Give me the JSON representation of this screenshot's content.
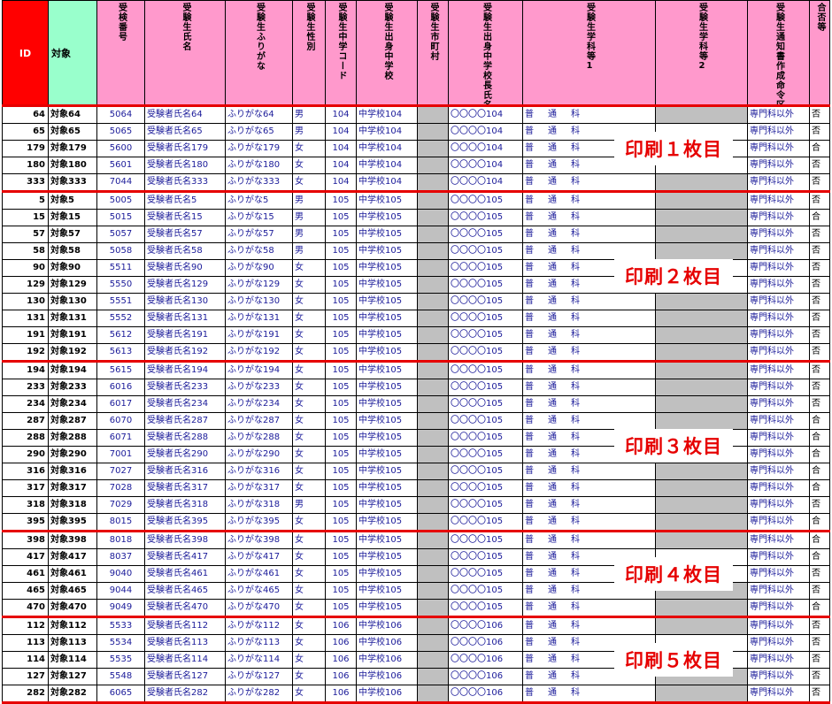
{
  "headers": {
    "id": "ID",
    "target": "対象",
    "exam_no": "受検番号",
    "name": "受験生氏名",
    "kana": "受験生ふりがな",
    "sex": "受験生性別",
    "jhs_code": "受験生中学コード",
    "jhs": "受験生出身中学校",
    "city": "受験生市町村",
    "principal": "受験生出身中学校長氏名",
    "course1": "受験生学科等1",
    "course2": "受験生学科等2",
    "notice": "受験生通知書作成命令区分",
    "pass": "合否等"
  },
  "print_labels": [
    "印刷１枚目",
    "印刷２枚目",
    "印刷３枚目",
    "印刷４枚目",
    "印刷５枚目"
  ],
  "groups": [
    {
      "rows": [
        {
          "id": "64",
          "target": "対象64",
          "exam": "5064",
          "name": "受験者氏名64",
          "kana": "ふりがな64",
          "sex": "男",
          "code": "104",
          "school": "中学校104",
          "principal": "〇〇〇〇104",
          "c1": [
            "普",
            "通",
            "科"
          ],
          "c2grey": true,
          "notice": "専門科以外",
          "pass": "否"
        },
        {
          "id": "65",
          "target": "対象65",
          "exam": "5065",
          "name": "受験者氏名65",
          "kana": "ふりがな65",
          "sex": "男",
          "code": "104",
          "school": "中学校104",
          "principal": "〇〇〇〇104",
          "c1": [
            "普",
            "通",
            "科"
          ],
          "c2grey": false,
          "notice": "専門科以外",
          "pass": "否"
        },
        {
          "id": "179",
          "target": "対象179",
          "exam": "5600",
          "name": "受験者氏名179",
          "kana": "ふりがな179",
          "sex": "女",
          "code": "104",
          "school": "中学校104",
          "principal": "〇〇〇〇104",
          "c1": [
            "普",
            "通",
            "科"
          ],
          "c2grey": false,
          "notice": "専門科以外",
          "pass": "合"
        },
        {
          "id": "180",
          "target": "対象180",
          "exam": "5601",
          "name": "受験者氏名180",
          "kana": "ふりがな180",
          "sex": "女",
          "code": "104",
          "school": "中学校104",
          "principal": "〇〇〇〇104",
          "c1": [
            "普",
            "通",
            "科"
          ],
          "c2grey": false,
          "notice": "専門科以外",
          "pass": "否"
        },
        {
          "id": "333",
          "target": "対象333",
          "exam": "7044",
          "name": "受験者氏名333",
          "kana": "ふりがな333",
          "sex": "女",
          "code": "104",
          "school": "中学校104",
          "principal": "〇〇〇〇104",
          "c1": [
            "普",
            "通",
            "科"
          ],
          "c2grey": true,
          "notice": "専門科以外",
          "pass": "否"
        }
      ]
    },
    {
      "rows": [
        {
          "id": "5",
          "target": "対象5",
          "exam": "5005",
          "name": "受験者氏名5",
          "kana": "ふりがな5",
          "sex": "男",
          "code": "105",
          "school": "中学校105",
          "principal": "〇〇〇〇105",
          "c1": [
            "普",
            "通",
            "科"
          ],
          "c2grey": true,
          "notice": "専門科以外",
          "pass": "否"
        },
        {
          "id": "15",
          "target": "対象15",
          "exam": "5015",
          "name": "受験者氏名15",
          "kana": "ふりがな15",
          "sex": "男",
          "code": "105",
          "school": "中学校105",
          "principal": "〇〇〇〇105",
          "c1": [
            "普",
            "通",
            "科"
          ],
          "c2grey": true,
          "notice": "専門科以外",
          "pass": "合"
        },
        {
          "id": "57",
          "target": "対象57",
          "exam": "5057",
          "name": "受験者氏名57",
          "kana": "ふりがな57",
          "sex": "男",
          "code": "105",
          "school": "中学校105",
          "principal": "〇〇〇〇105",
          "c1": [
            "普",
            "通",
            "科"
          ],
          "c2grey": true,
          "notice": "専門科以外",
          "pass": "否"
        },
        {
          "id": "58",
          "target": "対象58",
          "exam": "5058",
          "name": "受験者氏名58",
          "kana": "ふりがな58",
          "sex": "男",
          "code": "105",
          "school": "中学校105",
          "principal": "〇〇〇〇105",
          "c1": [
            "普",
            "通",
            "科"
          ],
          "c2grey": true,
          "notice": "専門科以外",
          "pass": "否"
        },
        {
          "id": "90",
          "target": "対象90",
          "exam": "5511",
          "name": "受験者氏名90",
          "kana": "ふりがな90",
          "sex": "女",
          "code": "105",
          "school": "中学校105",
          "principal": "〇〇〇〇105",
          "c1": [
            "普",
            "通",
            "科"
          ],
          "c2grey": false,
          "notice": "専門科以外",
          "pass": "否"
        },
        {
          "id": "129",
          "target": "対象129",
          "exam": "5550",
          "name": "受験者氏名129",
          "kana": "ふりがな129",
          "sex": "女",
          "code": "105",
          "school": "中学校105",
          "principal": "〇〇〇〇105",
          "c1": [
            "普",
            "通",
            "科"
          ],
          "c2grey": false,
          "notice": "専門科以外",
          "pass": "否"
        },
        {
          "id": "130",
          "target": "対象130",
          "exam": "5551",
          "name": "受験者氏名130",
          "kana": "ふりがな130",
          "sex": "女",
          "code": "105",
          "school": "中学校105",
          "principal": "〇〇〇〇105",
          "c1": [
            "普",
            "通",
            "科"
          ],
          "c2grey": true,
          "notice": "専門科以外",
          "pass": "否"
        },
        {
          "id": "131",
          "target": "対象131",
          "exam": "5552",
          "name": "受験者氏名131",
          "kana": "ふりがな131",
          "sex": "女",
          "code": "105",
          "school": "中学校105",
          "principal": "〇〇〇〇105",
          "c1": [
            "普",
            "通",
            "科"
          ],
          "c2grey": true,
          "notice": "専門科以外",
          "pass": "否"
        },
        {
          "id": "191",
          "target": "対象191",
          "exam": "5612",
          "name": "受験者氏名191",
          "kana": "ふりがな191",
          "sex": "女",
          "code": "105",
          "school": "中学校105",
          "principal": "〇〇〇〇105",
          "c1": [
            "普",
            "通",
            "科"
          ],
          "c2grey": true,
          "notice": "専門科以外",
          "pass": "否"
        },
        {
          "id": "192",
          "target": "対象192",
          "exam": "5613",
          "name": "受験者氏名192",
          "kana": "ふりがな192",
          "sex": "女",
          "code": "105",
          "school": "中学校105",
          "principal": "〇〇〇〇105",
          "c1": [
            "普",
            "通",
            "科"
          ],
          "c2grey": true,
          "notice": "専門科以外",
          "pass": "否"
        }
      ]
    },
    {
      "rows": [
        {
          "id": "194",
          "target": "対象194",
          "exam": "5615",
          "name": "受験者氏名194",
          "kana": "ふりがな194",
          "sex": "女",
          "code": "105",
          "school": "中学校105",
          "principal": "〇〇〇〇105",
          "c1": [
            "普",
            "通",
            "科"
          ],
          "c2grey": true,
          "notice": "専門科以外",
          "pass": "否"
        },
        {
          "id": "233",
          "target": "対象233",
          "exam": "6016",
          "name": "受験者氏名233",
          "kana": "ふりがな233",
          "sex": "女",
          "code": "105",
          "school": "中学校105",
          "principal": "〇〇〇〇105",
          "c1": [
            "普",
            "通",
            "科"
          ],
          "c2grey": true,
          "notice": "専門科以外",
          "pass": "否"
        },
        {
          "id": "234",
          "target": "対象234",
          "exam": "6017",
          "name": "受験者氏名234",
          "kana": "ふりがな234",
          "sex": "女",
          "code": "105",
          "school": "中学校105",
          "principal": "〇〇〇〇105",
          "c1": [
            "普",
            "通",
            "科"
          ],
          "c2grey": true,
          "notice": "専門科以外",
          "pass": "否"
        },
        {
          "id": "287",
          "target": "対象287",
          "exam": "6070",
          "name": "受験者氏名287",
          "kana": "ふりがな287",
          "sex": "女",
          "code": "105",
          "school": "中学校105",
          "principal": "〇〇〇〇105",
          "c1": [
            "普",
            "通",
            "科"
          ],
          "c2grey": true,
          "notice": "専門科以外",
          "pass": "合"
        },
        {
          "id": "288",
          "target": "対象288",
          "exam": "6071",
          "name": "受験者氏名288",
          "kana": "ふりがな288",
          "sex": "女",
          "code": "105",
          "school": "中学校105",
          "principal": "〇〇〇〇105",
          "c1": [
            "普",
            "通",
            "科"
          ],
          "c2grey": false,
          "notice": "専門科以外",
          "pass": "合"
        },
        {
          "id": "290",
          "target": "対象290",
          "exam": "7001",
          "name": "受験者氏名290",
          "kana": "ふりがな290",
          "sex": "女",
          "code": "105",
          "school": "中学校105",
          "principal": "〇〇〇〇105",
          "c1": [
            "普",
            "通",
            "科"
          ],
          "c2grey": false,
          "notice": "専門科以外",
          "pass": "合"
        },
        {
          "id": "316",
          "target": "対象316",
          "exam": "7027",
          "name": "受験者氏名316",
          "kana": "ふりがな316",
          "sex": "女",
          "code": "105",
          "school": "中学校105",
          "principal": "〇〇〇〇105",
          "c1": [
            "普",
            "通",
            "科"
          ],
          "c2grey": true,
          "notice": "専門科以外",
          "pass": "合"
        },
        {
          "id": "317",
          "target": "対象317",
          "exam": "7028",
          "name": "受験者氏名317",
          "kana": "ふりがな317",
          "sex": "女",
          "code": "105",
          "school": "中学校105",
          "principal": "〇〇〇〇105",
          "c1": [
            "普",
            "通",
            "科"
          ],
          "c2grey": true,
          "notice": "専門科以外",
          "pass": "合"
        },
        {
          "id": "318",
          "target": "対象318",
          "exam": "7029",
          "name": "受験者氏名318",
          "kana": "ふりがな318",
          "sex": "男",
          "code": "105",
          "school": "中学校105",
          "principal": "〇〇〇〇105",
          "c1": [
            "普",
            "通",
            "科"
          ],
          "c2grey": true,
          "notice": "専門科以外",
          "pass": "否"
        },
        {
          "id": "395",
          "target": "対象395",
          "exam": "8015",
          "name": "受験者氏名395",
          "kana": "ふりがな395",
          "sex": "女",
          "code": "105",
          "school": "中学校105",
          "principal": "〇〇〇〇105",
          "c1": [
            "普",
            "通",
            "科"
          ],
          "c2grey": true,
          "notice": "専門科以外",
          "pass": "合"
        }
      ]
    },
    {
      "rows": [
        {
          "id": "398",
          "target": "対象398",
          "exam": "8018",
          "name": "受験者氏名398",
          "kana": "ふりがな398",
          "sex": "女",
          "code": "105",
          "school": "中学校105",
          "principal": "〇〇〇〇105",
          "c1": [
            "普",
            "通",
            "科"
          ],
          "c2grey": true,
          "notice": "専門科以外",
          "pass": "合"
        },
        {
          "id": "417",
          "target": "対象417",
          "exam": "8037",
          "name": "受験者氏名417",
          "kana": "ふりがな417",
          "sex": "女",
          "code": "105",
          "school": "中学校105",
          "principal": "〇〇〇〇105",
          "c1": [
            "普",
            "通",
            "科"
          ],
          "c2grey": false,
          "notice": "専門科以外",
          "pass": "合"
        },
        {
          "id": "461",
          "target": "対象461",
          "exam": "9040",
          "name": "受験者氏名461",
          "kana": "ふりがな461",
          "sex": "女",
          "code": "105",
          "school": "中学校105",
          "principal": "〇〇〇〇105",
          "c1": [
            "普",
            "通",
            "科"
          ],
          "c2grey": false,
          "notice": "専門科以外",
          "pass": "否"
        },
        {
          "id": "465",
          "target": "対象465",
          "exam": "9044",
          "name": "受験者氏名465",
          "kana": "ふりがな465",
          "sex": "女",
          "code": "105",
          "school": "中学校105",
          "principal": "〇〇〇〇105",
          "c1": [
            "普",
            "通",
            "科"
          ],
          "c2grey": true,
          "notice": "専門科以外",
          "pass": "否"
        },
        {
          "id": "470",
          "target": "対象470",
          "exam": "9049",
          "name": "受験者氏名470",
          "kana": "ふりがな470",
          "sex": "女",
          "code": "105",
          "school": "中学校105",
          "principal": "〇〇〇〇105",
          "c1": [
            "普",
            "通",
            "科"
          ],
          "c2grey": true,
          "notice": "専門科以外",
          "pass": "合"
        }
      ]
    },
    {
      "rows": [
        {
          "id": "112",
          "target": "対象112",
          "exam": "5533",
          "name": "受験者氏名112",
          "kana": "ふりがな112",
          "sex": "女",
          "code": "106",
          "school": "中学校106",
          "principal": "〇〇〇〇106",
          "c1": [
            "普",
            "通",
            "科"
          ],
          "c2grey": true,
          "notice": "専門科以外",
          "pass": "否"
        },
        {
          "id": "113",
          "target": "対象113",
          "exam": "5534",
          "name": "受験者氏名113",
          "kana": "ふりがな113",
          "sex": "女",
          "code": "106",
          "school": "中学校106",
          "principal": "〇〇〇〇106",
          "c1": [
            "普",
            "通",
            "科"
          ],
          "c2grey": false,
          "notice": "専門科以外",
          "pass": "否"
        },
        {
          "id": "114",
          "target": "対象114",
          "exam": "5535",
          "name": "受験者氏名114",
          "kana": "ふりがな114",
          "sex": "女",
          "code": "106",
          "school": "中学校106",
          "principal": "〇〇〇〇106",
          "c1": [
            "普",
            "通",
            "科"
          ],
          "c2grey": false,
          "notice": "専門科以外",
          "pass": "否"
        },
        {
          "id": "127",
          "target": "対象127",
          "exam": "5548",
          "name": "受験者氏名127",
          "kana": "ふりがな127",
          "sex": "女",
          "code": "106",
          "school": "中学校106",
          "principal": "〇〇〇〇106",
          "c1": [
            "普",
            "通",
            "科"
          ],
          "c2grey": true,
          "notice": "専門科以外",
          "pass": "否"
        },
        {
          "id": "282",
          "target": "対象282",
          "exam": "6065",
          "name": "受験者氏名282",
          "kana": "ふりがな282",
          "sex": "女",
          "code": "106",
          "school": "中学校106",
          "principal": "〇〇〇〇106",
          "c1": [
            "普",
            "通",
            "科"
          ],
          "c2grey": true,
          "notice": "専門科以外",
          "pass": "否"
        }
      ]
    }
  ]
}
